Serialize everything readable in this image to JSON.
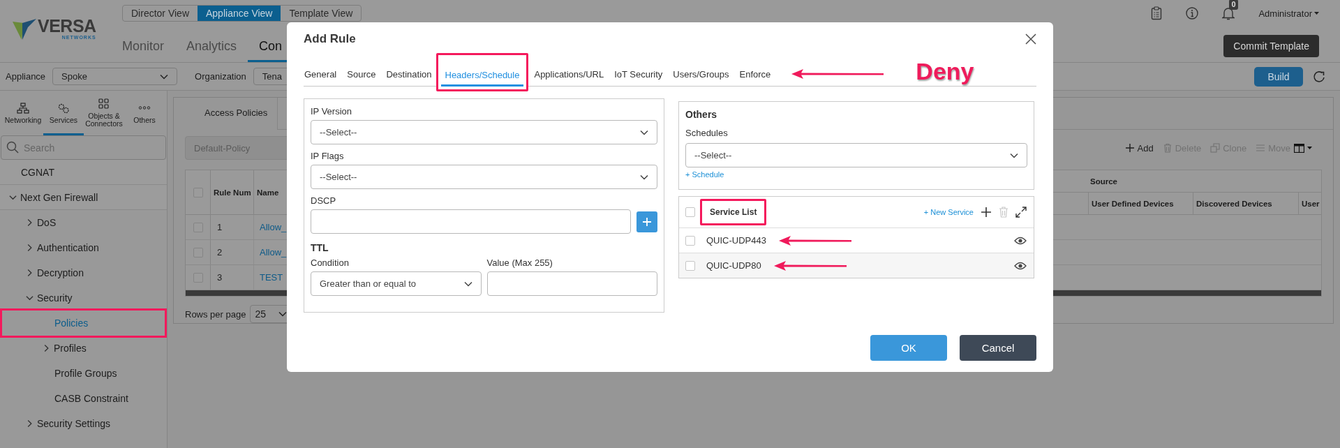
{
  "header": {
    "brand": {
      "name": "VERSA",
      "tagline": "NETWORKS"
    },
    "views": [
      {
        "label": "Director View",
        "selected": false
      },
      {
        "label": "Appliance View",
        "selected": true
      },
      {
        "label": "Template View",
        "selected": false
      }
    ],
    "nav": [
      {
        "label": "Monitor",
        "selected": false
      },
      {
        "label": "Analytics",
        "selected": false
      },
      {
        "label": "Con",
        "selected": true
      }
    ],
    "notifications": "0",
    "user": "Administrator",
    "commit_button": "Commit Template"
  },
  "filters": [
    {
      "label": "Appliance",
      "value": "Spoke"
    },
    {
      "label": "Organization",
      "value": "Tena"
    }
  ],
  "build_button": "Build",
  "sidebar": {
    "tabs": [
      {
        "label": "Networking",
        "kind": "network",
        "selected": false
      },
      {
        "label": "Services",
        "kind": "services",
        "selected": true
      },
      {
        "label": "Objects & Connectors",
        "kind": "objects",
        "selected": false
      },
      {
        "label": "Others",
        "kind": "others",
        "selected": false
      }
    ],
    "search": {
      "placeholder": "Search"
    },
    "tree": [
      {
        "label": "CGNAT",
        "selected": false,
        "highlighted": false
      },
      {
        "label": "Next Gen Firewall",
        "expanded": true,
        "selected": false,
        "highlighted": false,
        "children": [
          {
            "label": "DoS",
            "expanded": false,
            "selected": false,
            "highlighted": false
          },
          {
            "label": "Authentication",
            "expanded": false,
            "selected": false,
            "highlighted": false
          },
          {
            "label": "Decryption",
            "expanded": false,
            "selected": false,
            "highlighted": false
          },
          {
            "label": "Security",
            "expanded": true,
            "selected": false,
            "highlighted": false,
            "children": [
              {
                "label": "Policies",
                "selected": true,
                "highlighted": true
              },
              {
                "label": "Profiles",
                "expanded": false,
                "selected": false,
                "highlighted": false
              },
              {
                "label": "Profile Groups",
                "selected": false,
                "highlighted": false
              },
              {
                "label": "CASB Constraint",
                "selected": false,
                "highlighted": false
              }
            ]
          },
          {
            "label": "Security Settings",
            "expanded": false,
            "selected": false,
            "highlighted": false
          }
        ]
      }
    ]
  },
  "content": {
    "tabs": [
      {
        "label": "Access Policies",
        "selected": true
      }
    ],
    "policy": "Default-Policy",
    "actions": [
      {
        "label": "Add",
        "kind": "add",
        "disabled": false
      },
      {
        "label": "Delete",
        "kind": "delete",
        "disabled": true
      },
      {
        "label": "Clone",
        "kind": "clone",
        "disabled": true
      },
      {
        "label": "Move",
        "kind": "move",
        "disabled": true
      }
    ],
    "table": {
      "checked": false,
      "columns": [
        "Rule Num",
        "Name"
      ],
      "group": "Source",
      "group_columns": [
        "User Defined Devices",
        "Discovered Devices",
        "User"
      ],
      "rows": [
        {
          "rule_num": "1",
          "name": "Allow_",
          "checked": false
        },
        {
          "rule_num": "2",
          "name": "Allow_",
          "checked": false
        },
        {
          "rule_num": "3",
          "name": "TEST",
          "checked": false
        }
      ]
    },
    "rows_per_page": {
      "label": "Rows per page",
      "value": "25"
    }
  },
  "modal": {
    "title": "Add Rule",
    "tabs": [
      {
        "label": "General",
        "selected": false,
        "highlighted": false
      },
      {
        "label": "Source",
        "selected": false,
        "highlighted": false
      },
      {
        "label": "Destination",
        "selected": false,
        "highlighted": false
      },
      {
        "label": "Headers/Schedule",
        "selected": true,
        "highlighted": true
      },
      {
        "label": "Applications/URL",
        "selected": false,
        "highlighted": false
      },
      {
        "label": "IoT Security",
        "selected": false,
        "highlighted": false
      },
      {
        "label": "Users/Groups",
        "selected": false,
        "highlighted": false
      },
      {
        "label": "Enforce",
        "selected": false,
        "highlighted": false,
        "pointed": true
      }
    ],
    "annotation": "Deny",
    "headers": {
      "fields": [
        {
          "kind": "select",
          "label": "IP Version",
          "value": "--Select--"
        },
        {
          "kind": "select",
          "label": "IP Flags",
          "value": "--Select--"
        },
        {
          "kind": "input_add",
          "label": "DSCP"
        }
      ],
      "ttl": {
        "title": "TTL",
        "condition": {
          "label": "Condition",
          "value": "Greater than or equal to"
        },
        "value": {
          "label": "Value (Max 255)"
        }
      }
    },
    "others": {
      "title": "Others",
      "label": "Schedules",
      "value": "--Select--",
      "link": "+ Schedule"
    },
    "services": {
      "title": "Service List",
      "checked": false,
      "highlighted": true,
      "link": "+ New Service",
      "rows": [
        {
          "name": "QUIC-UDP443",
          "checked": false,
          "pointed": true
        },
        {
          "name": "QUIC-UDP80",
          "checked": false,
          "pointed": true
        }
      ]
    },
    "buttons": [
      {
        "label": "OK",
        "kind": "primary"
      },
      {
        "label": "Cancel",
        "kind": "secondary"
      }
    ]
  }
}
